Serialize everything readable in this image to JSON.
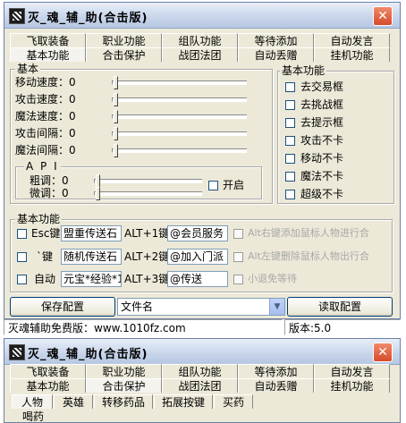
{
  "app": {
    "title": "灭_魂_辅_助(合击版)",
    "close_glyph": "✕"
  },
  "tabs_row1": [
    "飞取装备",
    "职业功能",
    "组队功能",
    "等待添加",
    "自动发言"
  ],
  "tabs_row2": [
    "基本功能",
    "合击保护",
    "战团法团",
    "自动丢赠",
    "挂机功能"
  ],
  "basic": {
    "group_label": "基本",
    "sliders": [
      {
        "label": "移动速度：0",
        "value": 0
      },
      {
        "label": "攻击速度：0",
        "value": 0
      },
      {
        "label": "魔法速度：0",
        "value": 0
      },
      {
        "label": "攻击间隔：0",
        "value": 0
      },
      {
        "label": "魔法间隔：0",
        "value": 0
      }
    ],
    "api_label": "A P I",
    "api_sliders": [
      {
        "label": "粗调：0",
        "value": 0
      },
      {
        "label": "微调：0",
        "value": 0
      }
    ],
    "open_label": "开启"
  },
  "basic_func_right": {
    "group_label": "基本功能",
    "items": [
      "去交易框",
      "去挑战框",
      "去提示框",
      "攻击不卡",
      "移动不卡",
      "魔法不卡",
      "超级不卡"
    ]
  },
  "hotkeys": {
    "group_label": "基本功能",
    "rows": [
      {
        "check": "Esc键",
        "input": "盟重传送石",
        "key": "ALT+1键",
        "value": "@会员服务",
        "note": "Alt右键添加鼠标人物进行合"
      },
      {
        "check": "`键",
        "input": "随机传送石",
        "key": "ALT+2键",
        "value": "@加入门派",
        "note": "Alt左键删除鼠标人物出行合"
      },
      {
        "check": "自动",
        "input": "元宝*经验*1",
        "key": "ALT+3键",
        "value": "@传送",
        "note": "小退免等待"
      }
    ]
  },
  "config": {
    "save_label": "保存配置",
    "file_value": "文件名",
    "load_label": "读取配置"
  },
  "statusbar": {
    "site": "灭魂辅助免费版：www.1010fz.com",
    "version": "版本:5.0"
  },
  "win2": {
    "title": "灭_魂_辅_助(合击版)",
    "subtabs": [
      "人物",
      "英雄",
      "转移药品",
      "拓展按键",
      "买药"
    ],
    "partial_label": "喝药"
  }
}
